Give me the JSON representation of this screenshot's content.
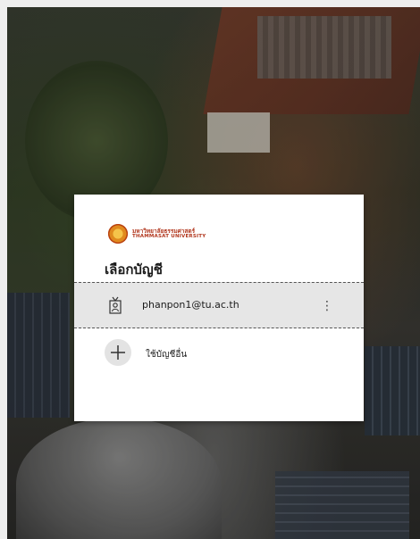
{
  "logo": {
    "thai_name": "มหาวิทยาลัยธรรมศาสตร์",
    "english_name": "THAMMASAT UNIVERSITY"
  },
  "title": "เลือกบัญชี",
  "account": {
    "email": "phanpon1@tu.ac.th",
    "more_label": "⋮"
  },
  "other_account": {
    "label": "ใช้บัญชีอื่น"
  },
  "colors": {
    "brand": "#b2381f",
    "card": "#ffffff",
    "selected_row": "#e6e6e6"
  }
}
